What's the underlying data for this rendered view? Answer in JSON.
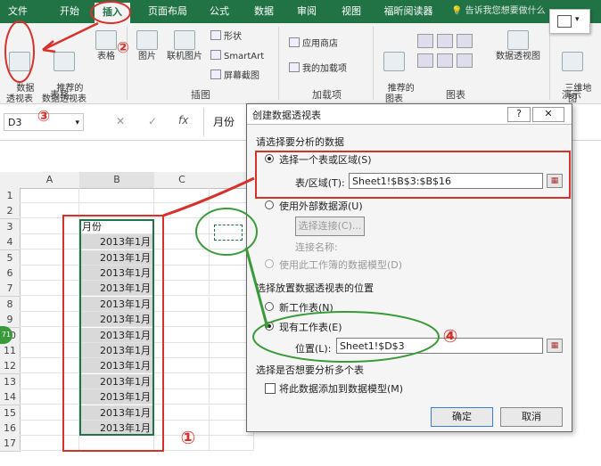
{
  "tabs": [
    "文件",
    "开始",
    "插入",
    "页面布局",
    "公式",
    "数据",
    "审阅",
    "视图",
    "福昕阅读器"
  ],
  "tell_me": "告诉我您想要做什么",
  "ribbon": {
    "groups": {
      "tables": "表格",
      "illustrations": "插图",
      "addins": "加载项",
      "charts": "图表",
      "demo": "演示"
    },
    "pivot_table": "数据\n透视表",
    "recommended_pivot": "推荐的\n数据透视表",
    "table": "表格",
    "picture": "图片",
    "online_picture": "联机图片",
    "shapes": "形状",
    "smartart": "SmartArt",
    "screenshot": "屏幕截图",
    "store": "应用商店",
    "my_addins": "我的加载项",
    "recommended_charts": "推荐的\n图表",
    "pivot_chart": "数据透视图",
    "map_3d": "三维地\n图"
  },
  "formula_bar": {
    "name_box": "D3",
    "fx": "fx",
    "content": "月份"
  },
  "grid": {
    "columns": [
      "A",
      "B",
      "C"
    ],
    "rows": [
      "1",
      "2",
      "3",
      "4",
      "5",
      "6",
      "7",
      "8",
      "9",
      "10",
      "11",
      "12",
      "13",
      "14",
      "15",
      "16",
      "17"
    ],
    "header": "月份",
    "values": [
      "2013年1月",
      "2013年1月",
      "2013年1月",
      "2013年1月",
      "2013年1月",
      "2013年1月",
      "2013年1月",
      "2013年1月",
      "2013年1月",
      "2013年1月",
      "2013年1月",
      "2013年1月",
      "2013年1月"
    ]
  },
  "dialog": {
    "title": "创建数据透视表",
    "help": "?",
    "section1": "请选择要分析的数据",
    "opt_range": "选择一个表或区域(S)",
    "range_label": "表/区域(T):",
    "range_value": "Sheet1!$B$3:$B$16",
    "opt_external": "使用外部数据源(U)",
    "choose_conn": "选择连接(C)...",
    "conn_name": "连接名称:",
    "opt_model": "使用此工作簿的数据模型(D)",
    "section2": "选择放置数据透视表的位置",
    "opt_new": "新工作表(N)",
    "opt_existing": "现有工作表(E)",
    "location_label": "位置(L):",
    "location_value": "Sheet1!$D$3",
    "section3": "选择是否想要分析多个表",
    "add_model": "将此数据添加到数据模型(M)",
    "ok": "确定",
    "cancel": "取消"
  },
  "annotations": [
    "①",
    "②",
    "③",
    "④"
  ],
  "side_badge": "71",
  "colors": {
    "excel_green": "#217346",
    "annotation_red": "#d6312b",
    "annotation_green": "#3a9a3a"
  }
}
